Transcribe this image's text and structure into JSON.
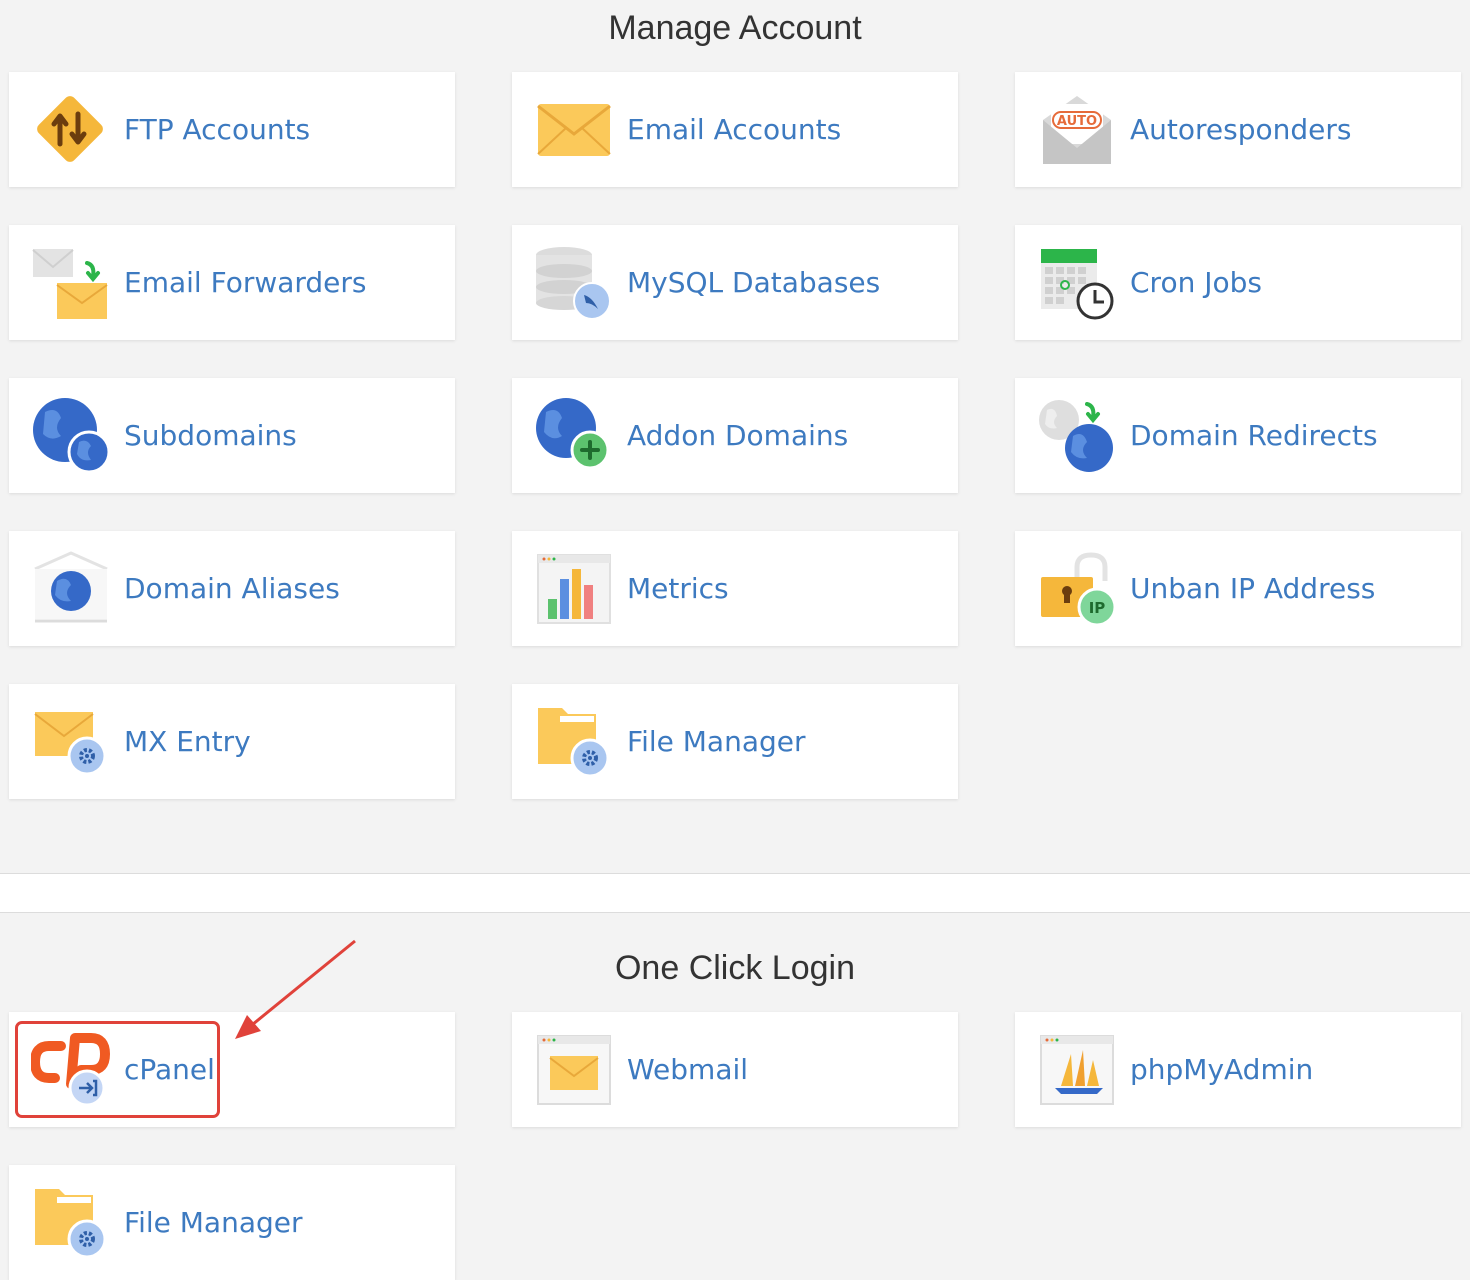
{
  "manage": {
    "title": "Manage Account",
    "tiles": [
      {
        "label": "FTP Accounts",
        "icon": "ftp-icon"
      },
      {
        "label": "Email Accounts",
        "icon": "email-envelope-icon"
      },
      {
        "label": "Autoresponders",
        "icon": "autoresponder-icon"
      },
      {
        "label": "Email Forwarders",
        "icon": "email-forwarder-icon"
      },
      {
        "label": "MySQL Databases",
        "icon": "mysql-database-icon"
      },
      {
        "label": "Cron Jobs",
        "icon": "cron-calendar-clock-icon"
      },
      {
        "label": "Subdomains",
        "icon": "subdomains-globe-icon"
      },
      {
        "label": "Addon Domains",
        "icon": "addon-domains-globe-plus-icon"
      },
      {
        "label": "Domain Redirects",
        "icon": "domain-redirect-globe-icon"
      },
      {
        "label": "Domain Aliases",
        "icon": "domain-aliases-globe-icon"
      },
      {
        "label": "Metrics",
        "icon": "metrics-bar-chart-icon"
      },
      {
        "label": "Unban IP Address",
        "icon": "unban-ip-padlock-icon"
      },
      {
        "label": "MX Entry",
        "icon": "mx-entry-envelope-gear-icon"
      },
      {
        "label": "File Manager",
        "icon": "file-manager-folder-gear-icon"
      }
    ]
  },
  "login": {
    "title": "One Click Login",
    "tiles": [
      {
        "label": "cPanel",
        "icon": "cpanel-logo-icon"
      },
      {
        "label": "Webmail",
        "icon": "webmail-window-envelope-icon"
      },
      {
        "label": "phpMyAdmin",
        "icon": "phpmyadmin-sailboat-icon"
      },
      {
        "label": "File Manager",
        "icon": "file-manager-folder-gear-icon"
      }
    ]
  },
  "colors": {
    "label": "#3d7ac0",
    "title": "#333333",
    "highlight": "#e0423a",
    "background": "#f3f3f3"
  }
}
